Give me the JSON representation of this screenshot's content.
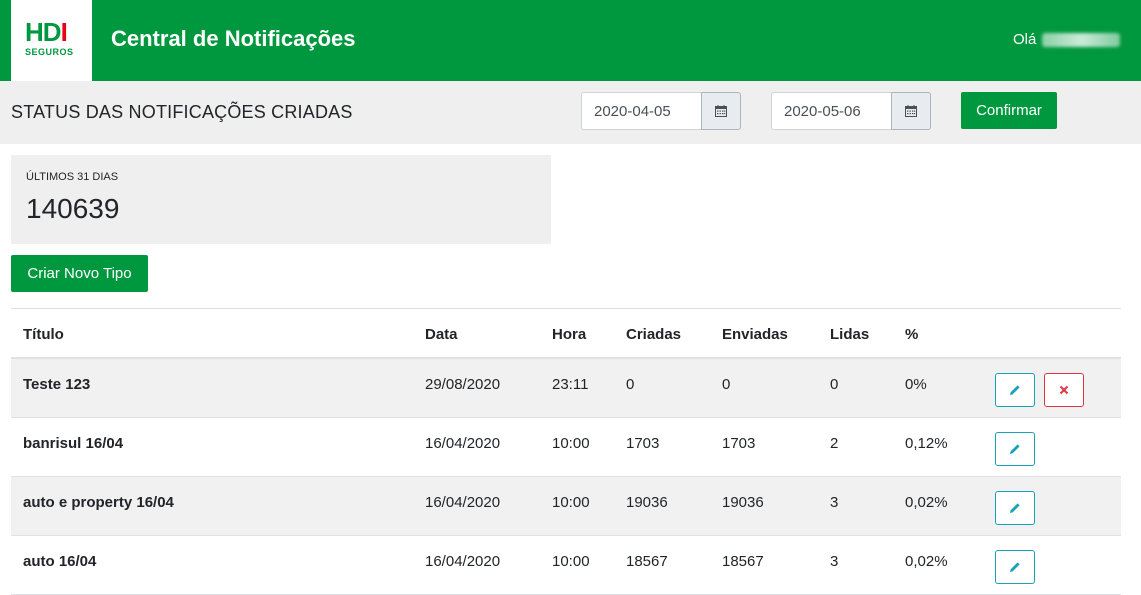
{
  "header": {
    "logo_text": "HDI",
    "logo_subtext": "SEGUROS",
    "app_title": "Central de Notificações",
    "greeting": "Olá"
  },
  "filter": {
    "section_title": "STATUS DAS NOTIFICAÇÕES CRIADAS",
    "start_date": "2020-04-05",
    "end_date": "2020-05-06",
    "confirm_label": "Confirmar",
    "calendar_icon": "calendar-icon"
  },
  "stats": {
    "label": "ÚLTIMOS 31 DIAS",
    "value": "140639"
  },
  "actions": {
    "new_type_label": "Criar Novo Tipo"
  },
  "table": {
    "columns": [
      "Título",
      "Data",
      "Hora",
      "Criadas",
      "Enviadas",
      "Lidas",
      "%"
    ],
    "rows": [
      {
        "titulo": "Teste 123",
        "data": "29/08/2020",
        "hora": "23:11",
        "criadas": "0",
        "enviadas": "0",
        "lidas": "0",
        "pct": "0%",
        "deletable": true
      },
      {
        "titulo": "banrisul 16/04",
        "data": "16/04/2020",
        "hora": "10:00",
        "criadas": "1703",
        "enviadas": "1703",
        "lidas": "2",
        "pct": "0,12%",
        "deletable": false
      },
      {
        "titulo": "auto e property 16/04",
        "data": "16/04/2020",
        "hora": "10:00",
        "criadas": "19036",
        "enviadas": "19036",
        "lidas": "3",
        "pct": "0,02%",
        "deletable": false
      },
      {
        "titulo": "auto 16/04",
        "data": "16/04/2020",
        "hora": "10:00",
        "criadas": "18567",
        "enviadas": "18567",
        "lidas": "3",
        "pct": "0,02%",
        "deletable": false
      }
    ]
  },
  "colors": {
    "brand_green": "#00983f",
    "logo_red": "#e30613",
    "edit_blue": "#17a2b8",
    "delete_red": "#dc3545"
  }
}
